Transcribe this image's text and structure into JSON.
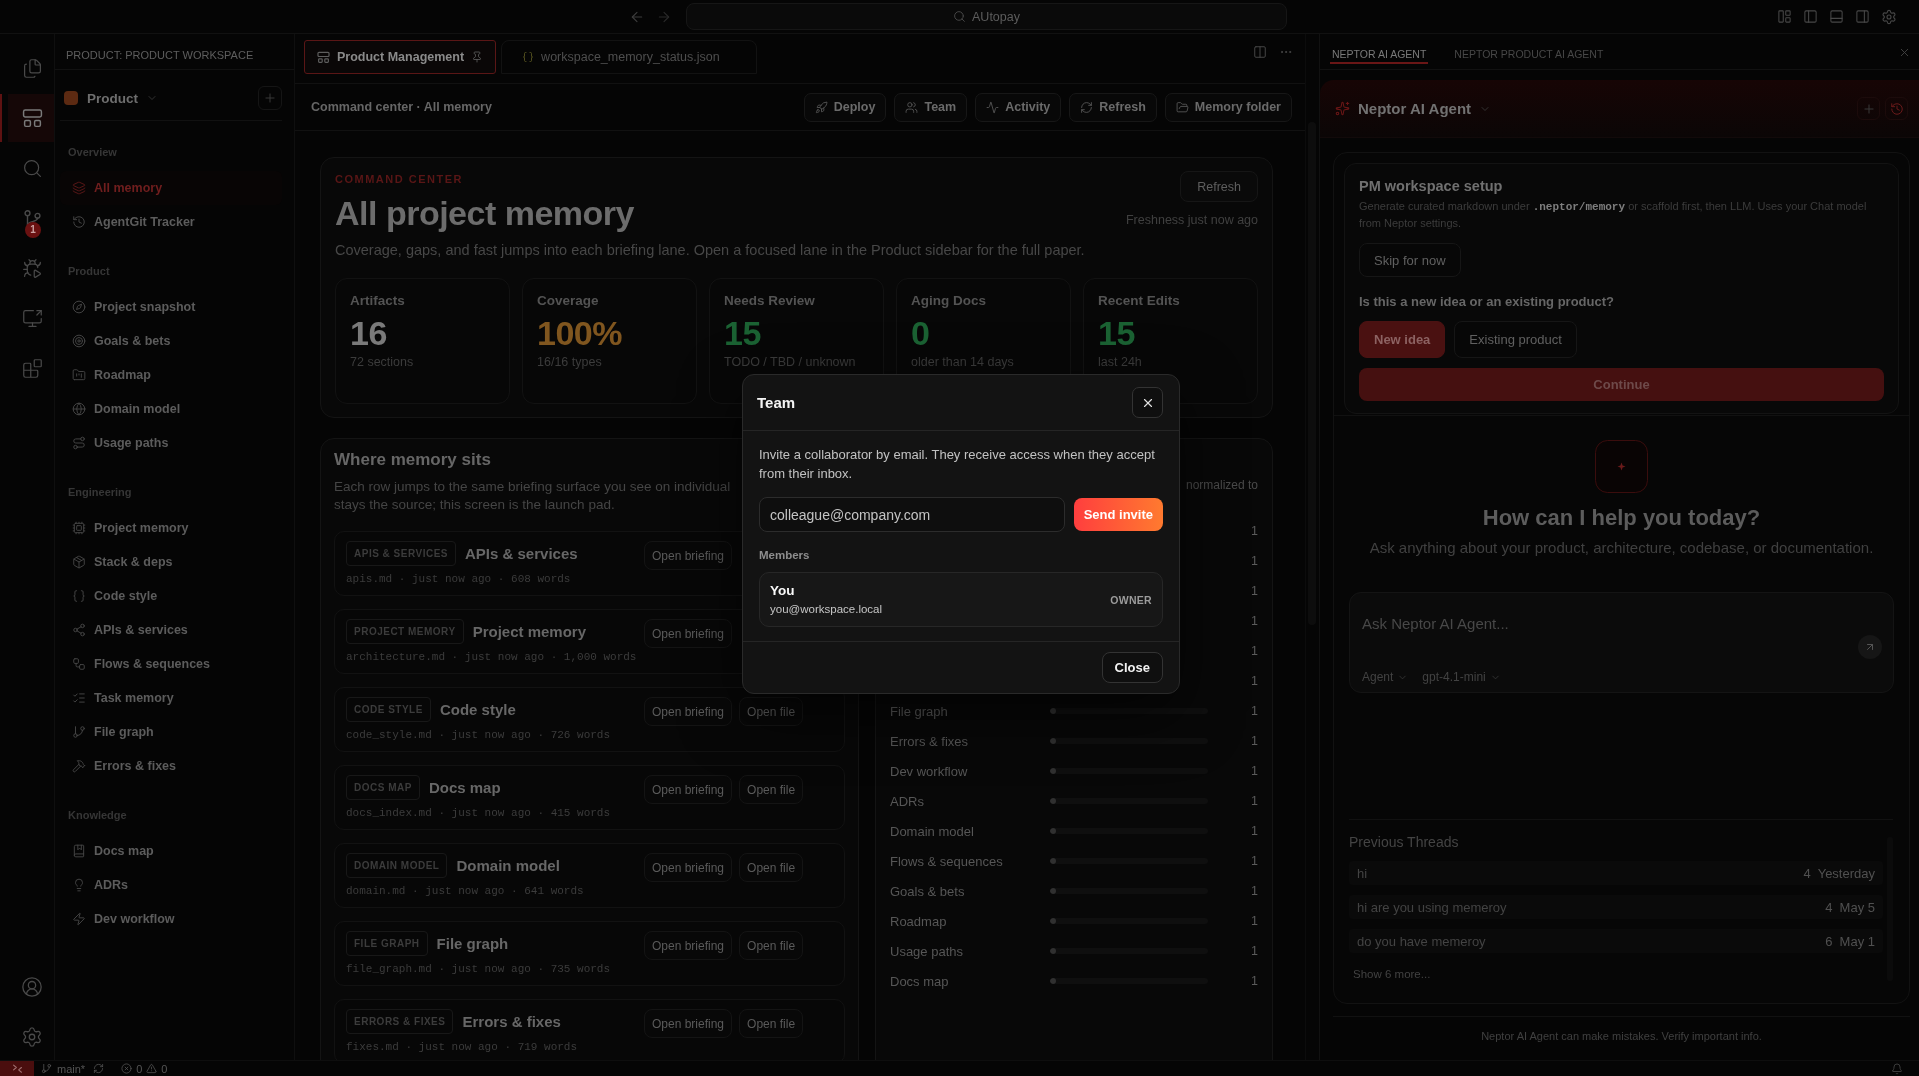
{
  "title_bar": {
    "search": "AUtopay"
  },
  "activity_bar": [
    {
      "selected": false
    },
    {
      "selected": true
    },
    {
      "selected": false
    },
    {
      "selected": false,
      "badge": "1"
    },
    {
      "selected": false
    },
    {
      "selected": false
    },
    {
      "selected": false
    }
  ],
  "sidebar": {
    "header": "PRODUCT: PRODUCT WORKSPACE",
    "workspace": "Product",
    "sections": [
      {
        "title": "Overview",
        "items": [
          {
            "label": "All memory",
            "selected": true
          },
          {
            "label": "AgentGit Tracker",
            "selected": false
          }
        ]
      },
      {
        "title": "Product",
        "items": [
          {
            "label": "Project snapshot",
            "selected": false
          },
          {
            "label": "Goals & bets",
            "selected": false
          },
          {
            "label": "Roadmap",
            "selected": false
          },
          {
            "label": "Domain model",
            "selected": false
          },
          {
            "label": "Usage paths",
            "selected": false
          }
        ]
      },
      {
        "title": "Engineering",
        "items": [
          {
            "label": "Project memory",
            "selected": false
          },
          {
            "label": "Stack & deps",
            "selected": false
          },
          {
            "label": "Code style",
            "selected": false
          },
          {
            "label": "APIs & services",
            "selected": false
          },
          {
            "label": "Flows & sequences",
            "selected": false
          },
          {
            "label": "Task memory",
            "selected": false
          },
          {
            "label": "File graph",
            "selected": false
          },
          {
            "label": "Errors & fixes",
            "selected": false
          }
        ]
      },
      {
        "title": "Knowledge",
        "items": [
          {
            "label": "Docs map",
            "selected": false
          },
          {
            "label": "ADRs",
            "selected": false
          },
          {
            "label": "Dev workflow",
            "selected": false
          }
        ]
      }
    ]
  },
  "editor_tabs": [
    {
      "label": "Product Management",
      "kind": "view",
      "selected": true,
      "pinned": true
    },
    {
      "label": "workspace_memory_status.json",
      "kind": "json",
      "selected": false,
      "pinned": false
    }
  ],
  "toolbar": {
    "breadcrumb": "Command center · All memory",
    "buttons": [
      "Deploy",
      "Team",
      "Activity",
      "Refresh",
      "Memory folder"
    ]
  },
  "hero": {
    "eyebrow": "COMMAND CENTER",
    "title": "All project memory",
    "refresh": "Refresh",
    "freshness": "Freshness just now ago",
    "description": "Coverage, gaps, and fast jumps into each briefing lane. Open a focused lane in the Product sidebar for the full paper.",
    "stats": [
      {
        "label": "Artifacts",
        "value": "16",
        "note": "72 sections",
        "color": "#7a7a7a"
      },
      {
        "label": "Coverage",
        "value": "100%",
        "note": "16/16 types",
        "color": "#80561f"
      },
      {
        "label": "Needs Review",
        "value": "15",
        "note": "TODO / TBD / unknown",
        "color": "#1b6233"
      },
      {
        "label": "Aging Docs",
        "value": "0",
        "note": "older than 14 days",
        "color": "#1b6233"
      },
      {
        "label": "Recent Edits",
        "value": "15",
        "note": "last 24h",
        "color": "#1b6233"
      }
    ]
  },
  "memory_map": {
    "title": "Where memory sits",
    "description_lines": [
      "Each row jumps to the same briefing surface you see on individual",
      "stays the source; this screen is the launch pad."
    ],
    "rows": [
      {
        "tag": "APIS & SERVICES",
        "title": "APIs & services",
        "meta": "apis.md · just now ago · 608 words",
        "actions": [
          "Open briefing"
        ]
      },
      {
        "tag": "PROJECT MEMORY",
        "title": "Project memory",
        "meta": "architecture.md · just now ago · 1,000 words",
        "actions": [
          "Open briefing"
        ]
      },
      {
        "tag": "CODE STYLE",
        "title": "Code style",
        "meta": "code_style.md · just now ago · 726 words",
        "actions": [
          "Open briefing",
          "Open file"
        ]
      },
      {
        "tag": "DOCS MAP",
        "title": "Docs map",
        "meta": "docs_index.md · just now ago · 415 words",
        "actions": [
          "Open briefing",
          "Open file"
        ]
      },
      {
        "tag": "DOMAIN MODEL",
        "title": "Domain model",
        "meta": "domain.md · just now ago · 641 words",
        "actions": [
          "Open briefing",
          "Open file"
        ]
      },
      {
        "tag": "FILE GRAPH",
        "title": "File graph",
        "meta": "file_graph.md · just now ago · 735 words",
        "actions": [
          "Open briefing",
          "Open file"
        ]
      },
      {
        "tag": "ERRORS & FIXES",
        "title": "Errors & fixes",
        "meta": "fixes.md · just now ago · 719 words",
        "actions": [
          "Open briefing",
          "Open file"
        ]
      }
    ]
  },
  "distribution": {
    "note": "normalized to",
    "rows": [
      {
        "value": "1"
      },
      {
        "value": "1"
      },
      {
        "value": "1"
      },
      {
        "value": "1"
      },
      {
        "value": "1"
      },
      {
        "value": "1"
      },
      {
        "label": "File graph",
        "level": 0.04,
        "value": "1"
      },
      {
        "label": "Errors & fixes",
        "level": 0.04,
        "value": "1"
      },
      {
        "label": "Dev workflow",
        "level": 0.04,
        "value": "1"
      },
      {
        "label": "ADRs",
        "level": 0.04,
        "value": "1"
      },
      {
        "label": "Domain model",
        "level": 0.04,
        "value": "1"
      },
      {
        "label": "Flows & sequences",
        "level": 0.04,
        "value": "1"
      },
      {
        "label": "Goals & bets",
        "level": 0.04,
        "value": "1"
      },
      {
        "label": "Roadmap",
        "level": 0.04,
        "value": "1"
      },
      {
        "label": "Usage paths",
        "level": 0.04,
        "value": "1"
      },
      {
        "label": "Docs map",
        "level": 0.04,
        "value": "1"
      }
    ]
  },
  "team_dialog": {
    "title": "Team",
    "description": "Invite a collaborator by email. They receive access when they accept from their inbox.",
    "email_placeholder": "colleague@company.com",
    "send_button": "Send invite",
    "members_label": "Members",
    "members": [
      {
        "name": "You",
        "email": "you@workspace.local",
        "role": "OWNER"
      }
    ],
    "close_button": "Close"
  },
  "agent_panel": {
    "tabs": [
      {
        "label": "NEPTOR AI AGENT",
        "selected": true
      },
      {
        "label": "NEPTOR PRODUCT AI AGENT",
        "selected": false
      }
    ],
    "agent_name": "Neptor AI Agent",
    "setup": {
      "title": "PM workspace setup",
      "description": [
        {
          "kind": "text",
          "text": "Generate curated markdown under "
        },
        {
          "kind": "code",
          "text": ".neptor/memory"
        },
        {
          "kind": "text",
          "text": " or scaffold first, then LLM. Uses your Chat model from Neptor settings."
        }
      ],
      "skip_button": "Skip for now",
      "question": "Is this a new idea or an existing product?",
      "options": [
        {
          "label": "New idea",
          "selected": true
        },
        {
          "label": "Existing product",
          "selected": false
        }
      ],
      "continue_button": "Continue"
    },
    "greeting": "How can I help you today?",
    "subtitle": "Ask anything about your product, architecture, codebase, or documentation.",
    "composer": {
      "placeholder": "Ask Neptor AI Agent...",
      "mode": "Agent",
      "model": "gpt-4.1-mini"
    },
    "threads_title": "Previous Threads",
    "threads": [
      {
        "title": "hi",
        "count": "4",
        "date": "Yesterday"
      },
      {
        "title": "hi are you using memeroy",
        "count": "4",
        "date": "May 5"
      },
      {
        "title": "do you have memeroy",
        "count": "6",
        "date": "May 1"
      }
    ],
    "show_more": "Show 6 more...",
    "disclaimer": "Neptor AI Agent can make mistakes. Verify important info."
  },
  "status_bar": {
    "branch": "main*",
    "errors": "0",
    "warnings": "0"
  }
}
